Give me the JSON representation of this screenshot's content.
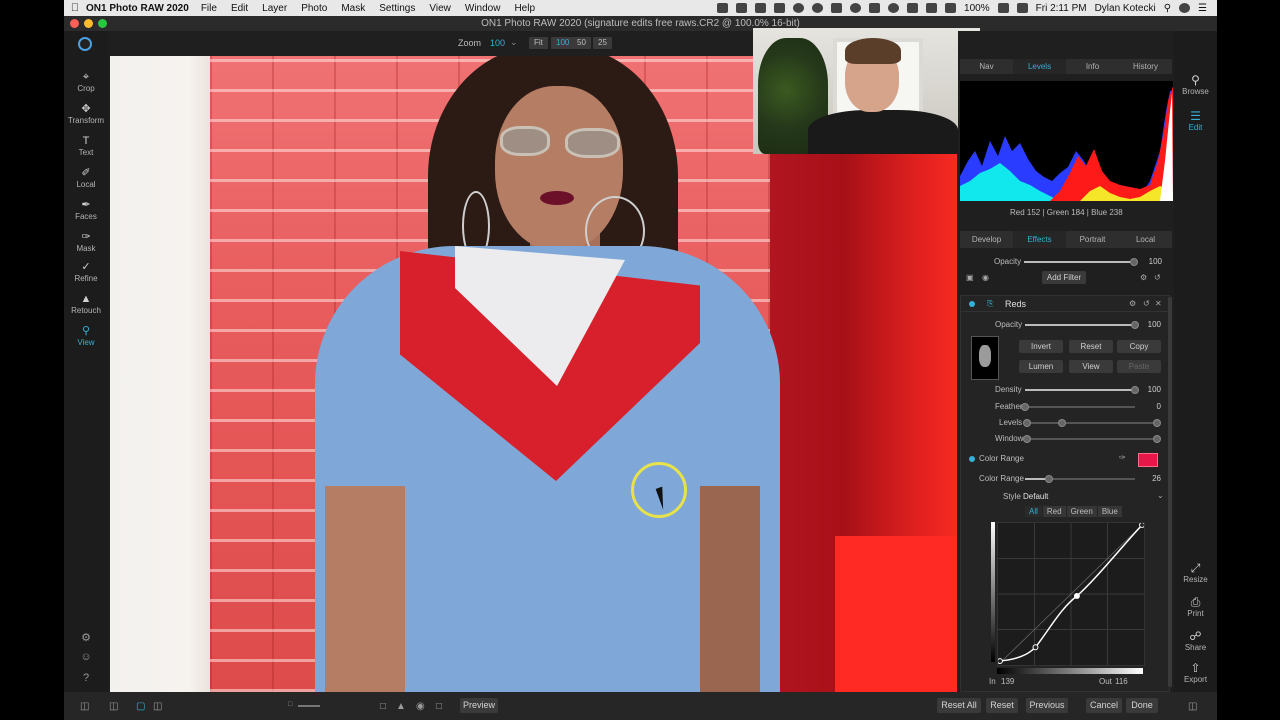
{
  "menubar": {
    "app_name": "ON1 Photo RAW 2020",
    "menus": [
      "File",
      "Edit",
      "Layer",
      "Photo",
      "Mask",
      "Settings",
      "View",
      "Window",
      "Help"
    ],
    "battery": "100%",
    "clock": "Fri 2:11 PM",
    "user": "Dylan Kotecki"
  },
  "window": {
    "title": "ON1 Photo RAW 2020 (signature edits free raws.CR2 @ 100.0% 16-bit)"
  },
  "tools": [
    {
      "label": "Crop",
      "icon": "crop-icon"
    },
    {
      "label": "Transform",
      "icon": "transform-icon"
    },
    {
      "label": "Text",
      "icon": "text-icon"
    },
    {
      "label": "Local",
      "icon": "brush-icon"
    },
    {
      "label": "Faces",
      "icon": "faces-icon"
    },
    {
      "label": "Mask",
      "icon": "mask-icon"
    },
    {
      "label": "Refine",
      "icon": "refine-icon"
    },
    {
      "label": "Retouch",
      "icon": "retouch-icon"
    },
    {
      "label": "View",
      "icon": "view-icon"
    }
  ],
  "zoom": {
    "label": "Zoom",
    "value": "100",
    "presets": [
      "Fit",
      "100",
      "50",
      "25"
    ]
  },
  "top_tabs": [
    "Nav",
    "Levels",
    "Info",
    "History"
  ],
  "pixel_readout": "Red 152 | Green 184 | Blue 238",
  "module_tabs": [
    "Develop",
    "Effects",
    "Portrait",
    "Local"
  ],
  "layer": {
    "opacity_label": "Opacity",
    "opacity_value": "100",
    "opacity_level": 1.0,
    "add_filter_label": "Add Filter"
  },
  "filter": {
    "name": "Reds",
    "opacity_label": "Opacity",
    "opacity_value": "100",
    "opacity_level": 1.0,
    "buttons": [
      "Invert",
      "Reset",
      "Copy",
      "Lumen",
      "View",
      "Paste"
    ],
    "density_label": "Density",
    "density_value": "100",
    "density_level": 1.0,
    "feather_label": "Feather",
    "feather_value": "0",
    "feather_level": 0.0,
    "levels_label": "Levels",
    "window_label": "Window",
    "color_range_toggle": "Color Range",
    "color_range_label": "Color Range",
    "color_range_value": "26",
    "color_range_level": 0.22,
    "swatch_color": "#e8174a",
    "style_label": "Style",
    "style_value": "Default",
    "curve_tabs": [
      "All",
      "Red",
      "Green",
      "Blue"
    ],
    "in_label": "In",
    "in_value": "139",
    "out_label": "Out",
    "out_value": "116"
  },
  "utility": [
    "Browse",
    "Edit",
    "Resize",
    "Print",
    "Share",
    "Export"
  ],
  "bottom": {
    "preview_label": "Preview",
    "buttons": [
      "Reset All",
      "Reset",
      "Previous",
      "Cancel",
      "Done"
    ]
  },
  "colors": {
    "accent": "#35b0d8",
    "swatch": "#e8174a"
  }
}
